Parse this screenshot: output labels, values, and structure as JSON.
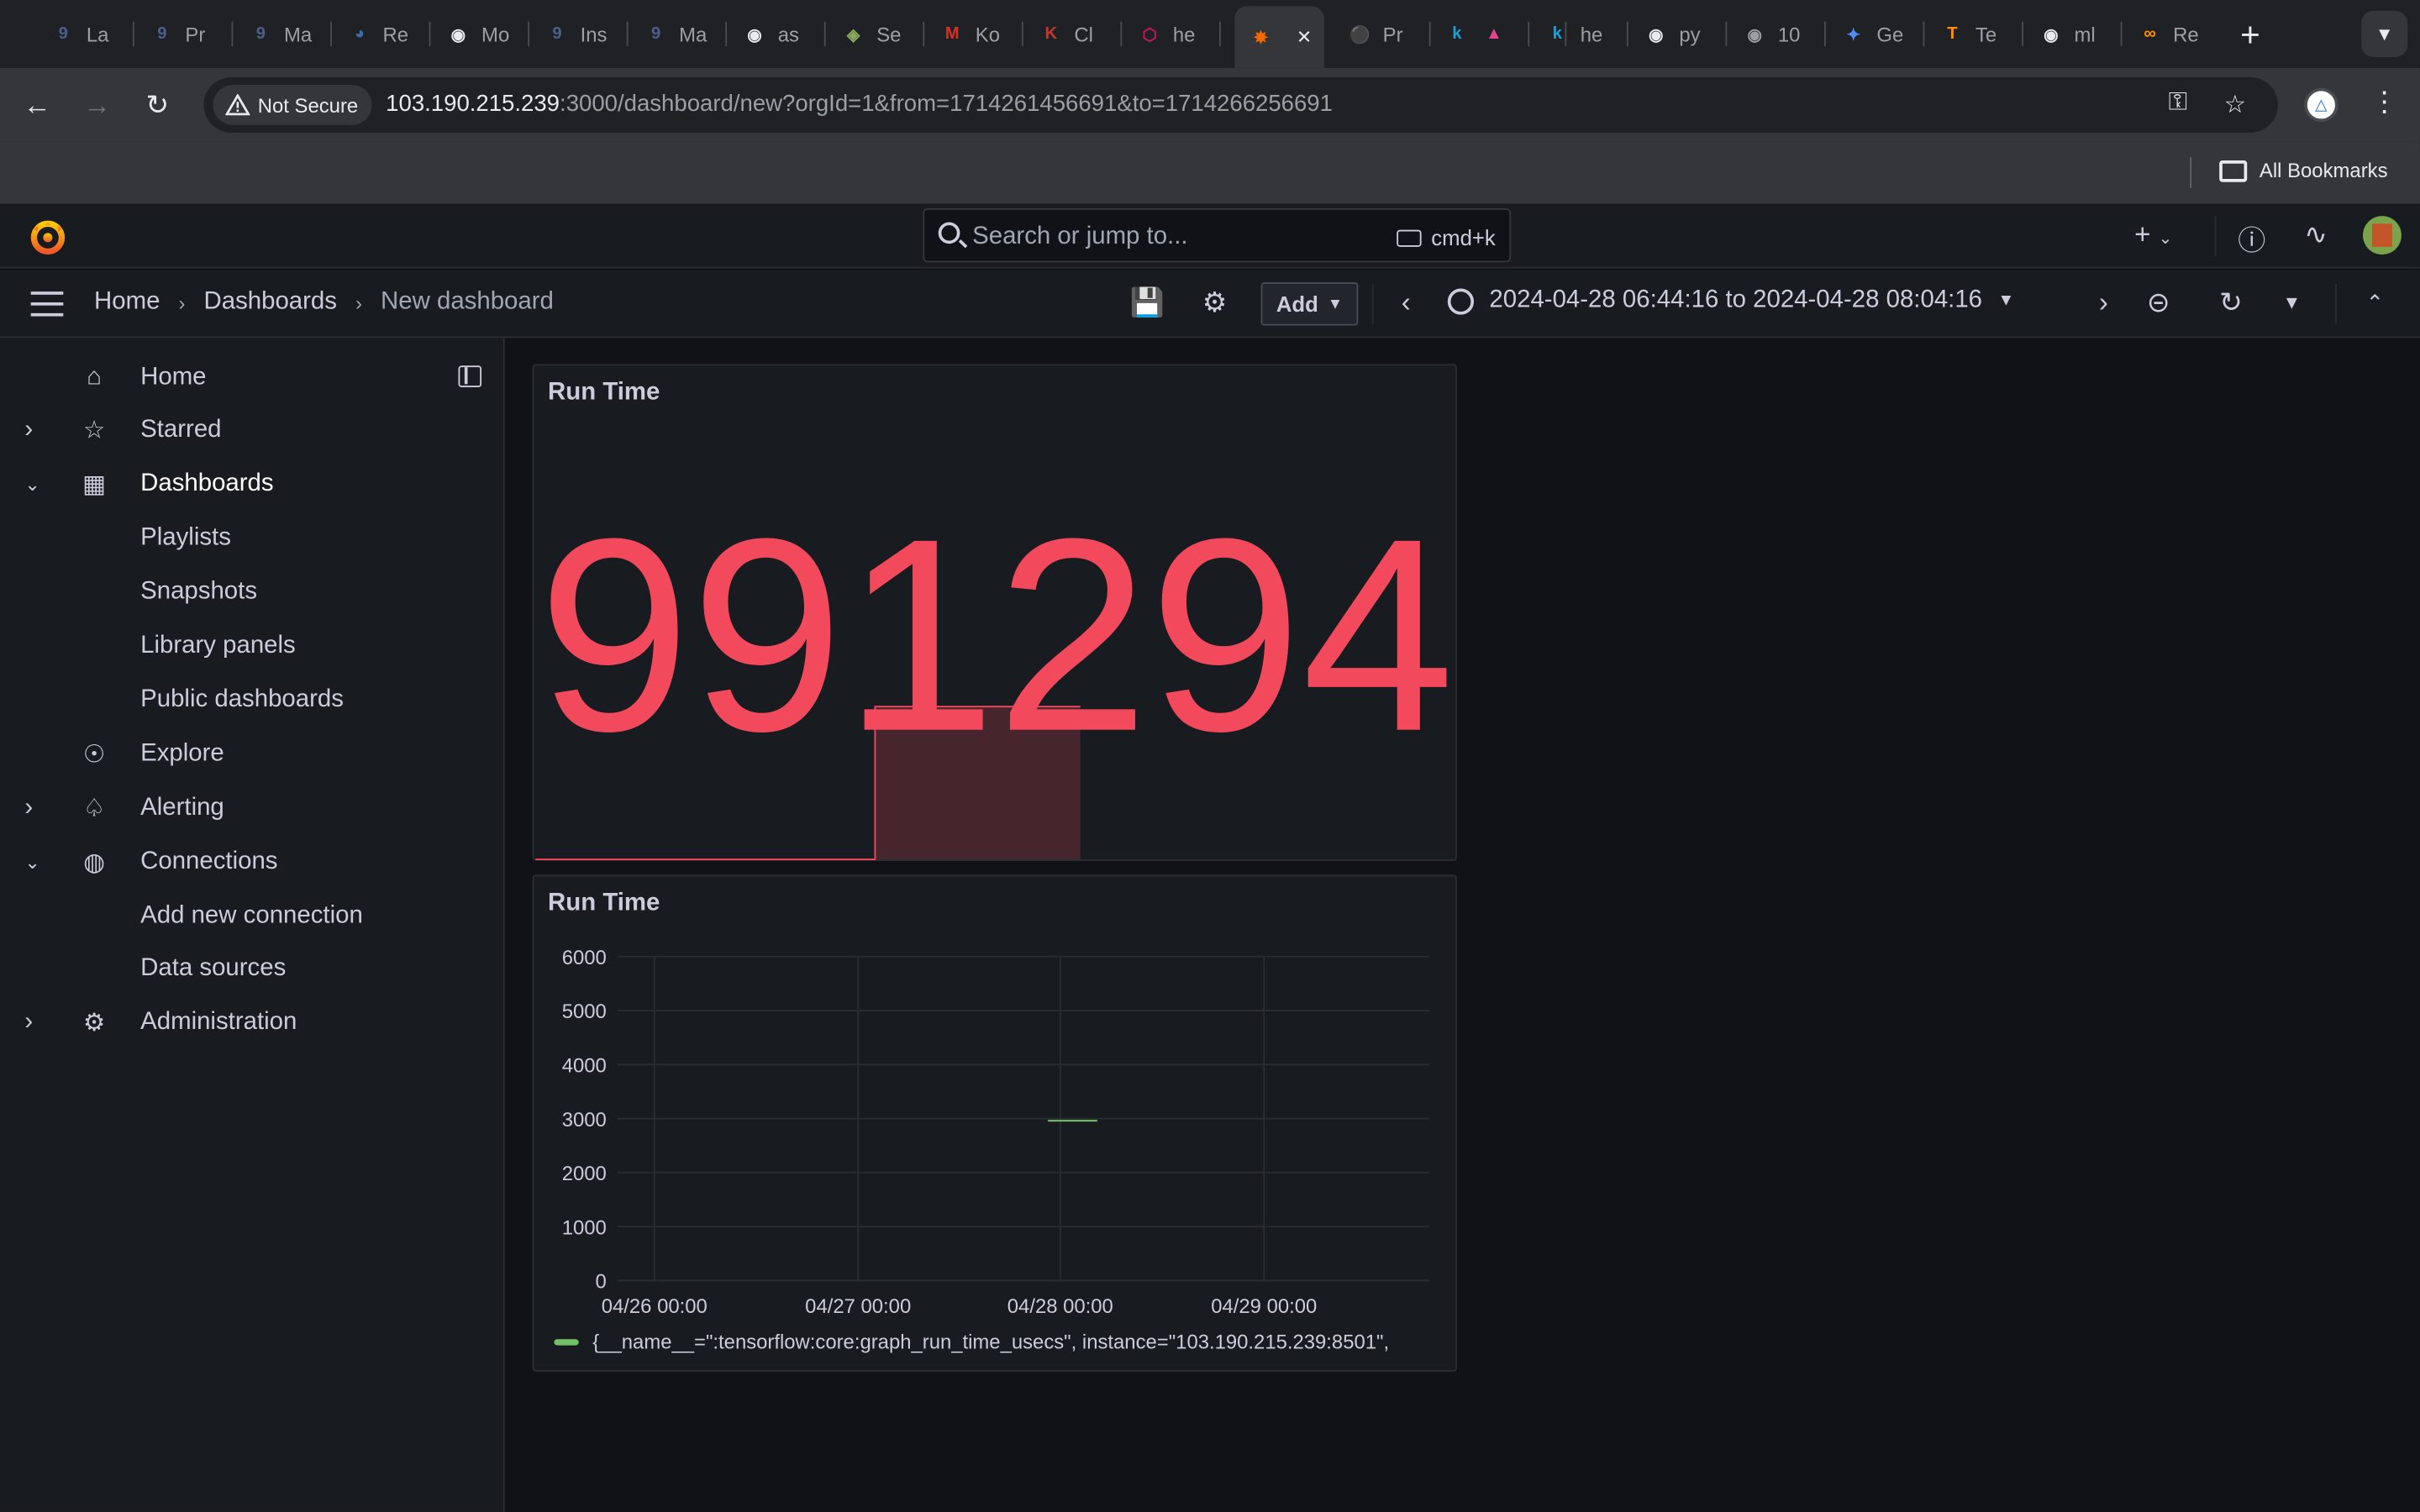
{
  "browser": {
    "tabs": [
      {
        "label": "La",
        "icon": "grafana-g-icon",
        "color": "#4a5f8a"
      },
      {
        "label": "Pr",
        "icon": "grafana-g-icon",
        "color": "#4a5f8a"
      },
      {
        "label": "Ma",
        "icon": "grafana-g-icon",
        "color": "#4a5f8a"
      },
      {
        "label": "Re",
        "icon": "planet-icon",
        "color": "#3b6ea8"
      },
      {
        "label": "Mo",
        "icon": "github-icon",
        "color": "#e8eaed"
      },
      {
        "label": "Ins",
        "icon": "grafana-g-icon",
        "color": "#4a5f8a"
      },
      {
        "label": "Ma",
        "icon": "grafana-g-icon",
        "color": "#4a5f8a"
      },
      {
        "label": "as",
        "icon": "github-icon",
        "color": "#e8eaed"
      },
      {
        "label": "Se",
        "icon": "globe-leaf-icon",
        "color": "#8aa860"
      },
      {
        "label": "Ko",
        "icon": "gmail-icon",
        "color": "#d93025"
      },
      {
        "label": "Cl",
        "icon": "k-logo-icon",
        "color": "#c0392b"
      },
      {
        "label": "he",
        "icon": "hexagon-icon",
        "color": "#c2185b"
      },
      {
        "label": "",
        "icon": "grafana-icon",
        "color": "#f46800"
      },
      {
        "label": "Pr",
        "icon": "prometheus-icon",
        "color": "#e6522c"
      },
      {
        "label": "",
        "icon": "k-icon",
        "color": "#1a9fd6"
      },
      {
        "label": "",
        "icon": "rocket-icon",
        "color": "#e84393"
      },
      {
        "label": "he",
        "icon": "k-icon",
        "color": "#1a9fd6"
      },
      {
        "label": "py",
        "icon": "github-icon",
        "color": "#e8eaed"
      },
      {
        "label": "10",
        "icon": "globe-icon",
        "color": "#9aa0a6"
      },
      {
        "label": "Ge",
        "icon": "sparkle-icon",
        "color": "#4f8ef7"
      },
      {
        "label": "Te",
        "icon": "tensorflow-icon",
        "color": "#ff8f00"
      },
      {
        "label": "ml",
        "icon": "github-icon",
        "color": "#e8eaed"
      },
      {
        "label": "Re",
        "icon": "infinity-icon",
        "color": "#ff9100"
      }
    ],
    "new_tab": "+",
    "security_label": "Not Secure",
    "url_host": "103.190.215.239",
    "url_rest": ":3000/dashboard/new?orgId=1&from=1714261456691&to=1714266256691",
    "bookmarks_label": "All Bookmarks"
  },
  "grafana": {
    "search_placeholder": "Search or jump to...",
    "search_shortcut": "cmd+k",
    "breadcrumbs": [
      "Home",
      "Dashboards",
      "New dashboard"
    ],
    "add_label": "Add",
    "time_range": "2024-04-28 06:44:16 to 2024-04-28 08:04:16",
    "nav": [
      {
        "label": "Home",
        "icon": "home-icon",
        "expander": ""
      },
      {
        "label": "Starred",
        "icon": "star-icon",
        "expander": "collapsed"
      },
      {
        "label": "Dashboards",
        "icon": "apps-icon",
        "expander": "expanded",
        "active": true
      },
      {
        "label": "Playlists",
        "sub": true
      },
      {
        "label": "Snapshots",
        "sub": true
      },
      {
        "label": "Library panels",
        "sub": true
      },
      {
        "label": "Public dashboards",
        "sub": true
      },
      {
        "label": "Explore",
        "icon": "compass-icon",
        "expander": ""
      },
      {
        "label": "Alerting",
        "icon": "bell-icon",
        "expander": "collapsed"
      },
      {
        "label": "Connections",
        "icon": "connections-icon",
        "expander": "expanded"
      },
      {
        "label": "Add new connection",
        "sub": true
      },
      {
        "label": "Data sources",
        "sub": true
      },
      {
        "label": "Administration",
        "icon": "cog-icon",
        "expander": "collapsed"
      }
    ]
  },
  "panels": {
    "stat": {
      "title": "Run Time",
      "value": "991294",
      "color": "#f2495c"
    },
    "timeseries": {
      "title": "Run Time",
      "legend": "{__name__=\":tensorflow:core:graph_run_time_usecs\", instance=\"103.190.215.239:8501\",",
      "series_color": "#73bf69"
    }
  },
  "chart_data": [
    {
      "type": "area",
      "title": "Run Time",
      "note_series": "sparkline",
      "x": [
        "before",
        "step",
        "after"
      ],
      "values": [
        0,
        991294,
        991294
      ],
      "color": "#f2495c"
    },
    {
      "type": "line",
      "title": "Run Time",
      "xlabel": "",
      "ylabel": "",
      "x_ticks": [
        "04/26 00:00",
        "04/27 00:00",
        "04/28 00:00",
        "04/29 00:00"
      ],
      "y_ticks": [
        0,
        1000,
        2000,
        3000,
        4000,
        5000,
        6000
      ],
      "ylim": [
        0,
        6000
      ],
      "grid": true,
      "legend": "bottom",
      "series": [
        {
          "name": "{__name__=\":tensorflow:core:graph_run_time_usecs\", instance=\"103.190.215.239:8501\",",
          "x": [
            "04/28 06:44",
            "04/28 08:04"
          ],
          "values": [
            2960,
            2960
          ]
        }
      ]
    }
  ]
}
